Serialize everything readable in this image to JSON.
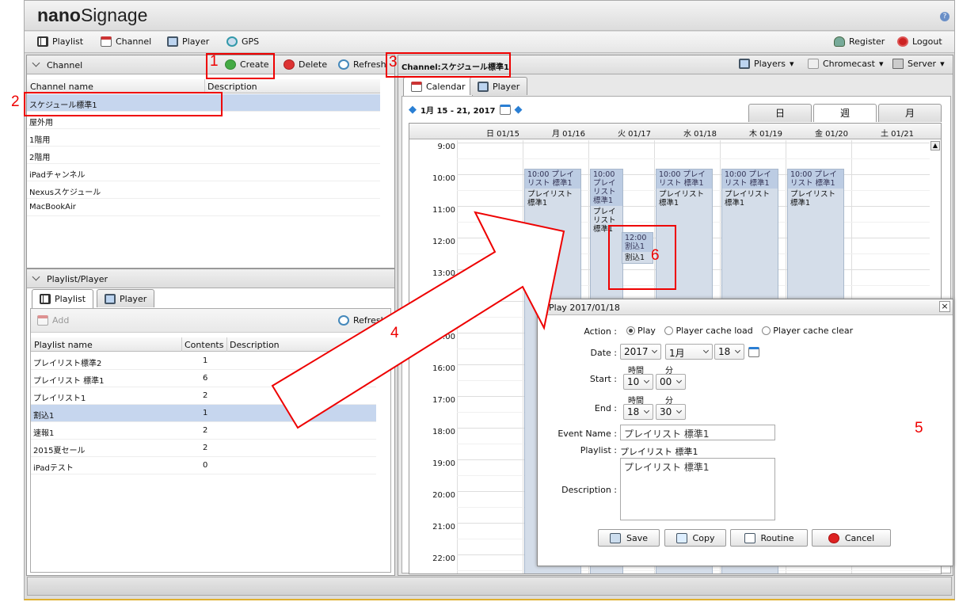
{
  "app": {
    "logo_bold": "nano",
    "logo_light": "Signage",
    "help": "?"
  },
  "menu": {
    "playlist": "Playlist",
    "channel": "Channel",
    "player": "Player",
    "gps": "GPS",
    "register": "Register",
    "logout": "Logout"
  },
  "channel_panel": {
    "title": "Channel",
    "create": "Create",
    "delete": "Delete",
    "refresh": "Refresh",
    "col_name": "Channel name",
    "col_desc": "Description",
    "rows": [
      "スケジュール標準1",
      "屋外用",
      "1階用",
      "2階用",
      "iPadチャンネル",
      "Nexusスケジュール",
      "MacBookAir"
    ]
  },
  "playlist_panel": {
    "title": "Playlist/Player",
    "tab_playlist": "Playlist",
    "tab_player": "Player",
    "add": "Add",
    "refresh": "Refresh",
    "col_name": "Playlist name",
    "col_contents": "Contents",
    "col_desc": "Description",
    "rows": [
      {
        "name": "プレイリスト標準2",
        "count": "1"
      },
      {
        "name": "プレイリスト 標準1",
        "count": "6"
      },
      {
        "name": "プレイリスト1",
        "count": "2"
      },
      {
        "name": "割込1",
        "count": "1"
      },
      {
        "name": "速報1",
        "count": "2"
      },
      {
        "name": "2015夏セール",
        "count": "2"
      },
      {
        "name": "iPadテスト",
        "count": "0"
      }
    ]
  },
  "right_header": {
    "channel_label": "Channel:スケジュール標準1",
    "players": "Players",
    "chromecast": "Chromecast",
    "server": "Server"
  },
  "calendar": {
    "tab_calendar": "Calendar",
    "tab_player": "Player",
    "range": "1月 15 - 21, 2017",
    "view_day": "日",
    "view_week": "週",
    "view_month": "月",
    "days": [
      "日 01/15",
      "月 01/16",
      "火 01/17",
      "水 01/18",
      "木 01/19",
      "金 01/20",
      "土 01/21"
    ],
    "hours": [
      "9:00",
      "10:00",
      "11:00",
      "12:00",
      "13:00",
      "14:00",
      "15:00",
      "16:00",
      "17:00",
      "18:00",
      "19:00",
      "20:00",
      "21:00",
      "22:00"
    ],
    "events": [
      {
        "time": "10:00 プレイリスト 標準1",
        "name": "プレイリスト 標準1"
      },
      {
        "time": "10:00 プレイリスト 標準1",
        "name": "プレイリスト 標準1"
      },
      {
        "time": "10:00 プレイリスト 標準1",
        "name": "プレイリスト 標準1"
      },
      {
        "time": "10:00 プレイリスト 標準1",
        "name": "プレイリスト 標準1"
      },
      {
        "time": "10:00 プレイリスト 標準1",
        "name": "プレイリスト 標準1"
      },
      {
        "time": "12:00 割込1",
        "name": "割込1"
      }
    ]
  },
  "dialog": {
    "title": "Play 2017/01/18",
    "close": "×",
    "action_label": "Action :",
    "opt_play": "Play",
    "opt_cache_load": "Player cache load",
    "opt_cache_clear": "Player cache clear",
    "date_label": "Date :",
    "year": "2017",
    "month": "1月",
    "day": "18",
    "hour_hdr": "時間",
    "min_hdr": "分",
    "start_label": "Start :",
    "start_h": "10",
    "start_m": "00",
    "end_label": "End :",
    "end_h": "18",
    "end_m": "30",
    "event_label": "Event Name :",
    "event_value": "プレイリスト 標準1",
    "playlist_label": "Playlist :",
    "playlist_value": "プレイリスト 標準1",
    "desc_label": "Description :",
    "desc_value": "プレイリスト 標準1",
    "save": "Save",
    "copy": "Copy",
    "routine": "Routine",
    "cancel": "Cancel"
  },
  "annotations": {
    "n1": "1",
    "n2": "2",
    "n3": "3",
    "n4": "4",
    "n5": "5",
    "n6": "6"
  },
  "colors": {
    "annotation": "#ee0000",
    "selected_row": "#c6d6ee",
    "event_bg": "#d4dde9"
  }
}
